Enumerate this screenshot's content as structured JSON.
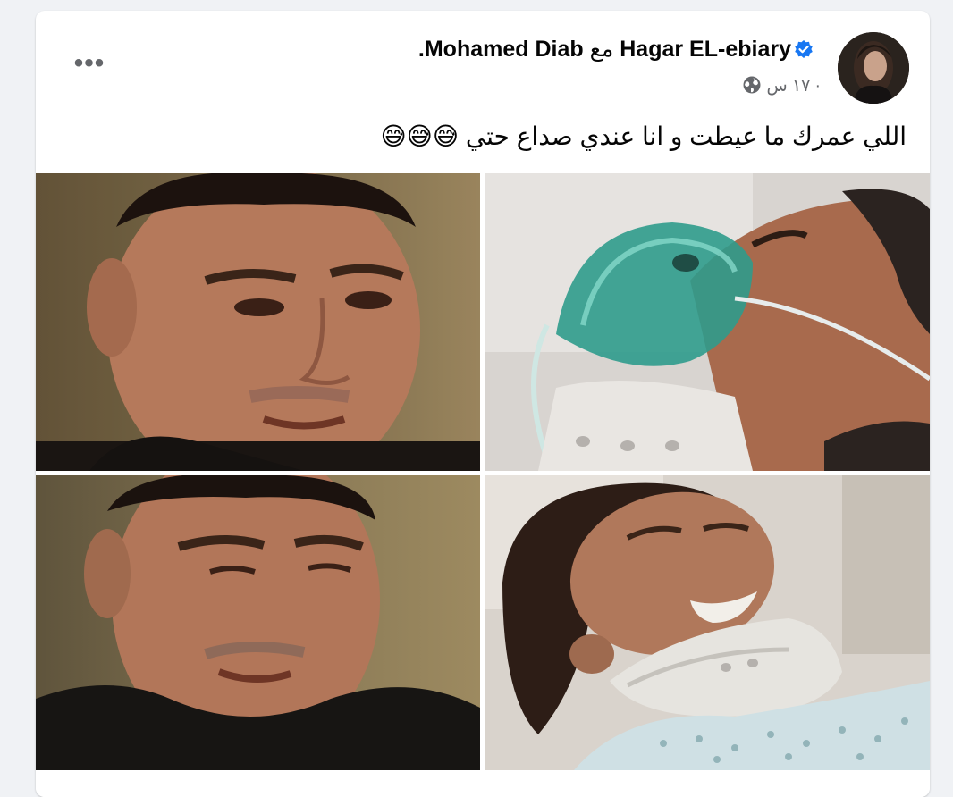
{
  "post": {
    "author": "Hagar EL-ebiary",
    "with_word": "مع",
    "tagged": "Mohamed Diab",
    "tagged_suffix": ".",
    "time": "١٧ س ·",
    "caption_text": "اللي عمرك ما عيطت و انا عندي صداع حتي",
    "caption_emojis": "😅😅😅",
    "more_label": "•••"
  },
  "icons": {
    "verified": "verified-badge-icon",
    "audience": "globe-icon",
    "more": "more-options-icon"
  },
  "colors": {
    "verified": "#1877f2",
    "secondary_text": "#65676b",
    "primary_text": "#050505"
  }
}
